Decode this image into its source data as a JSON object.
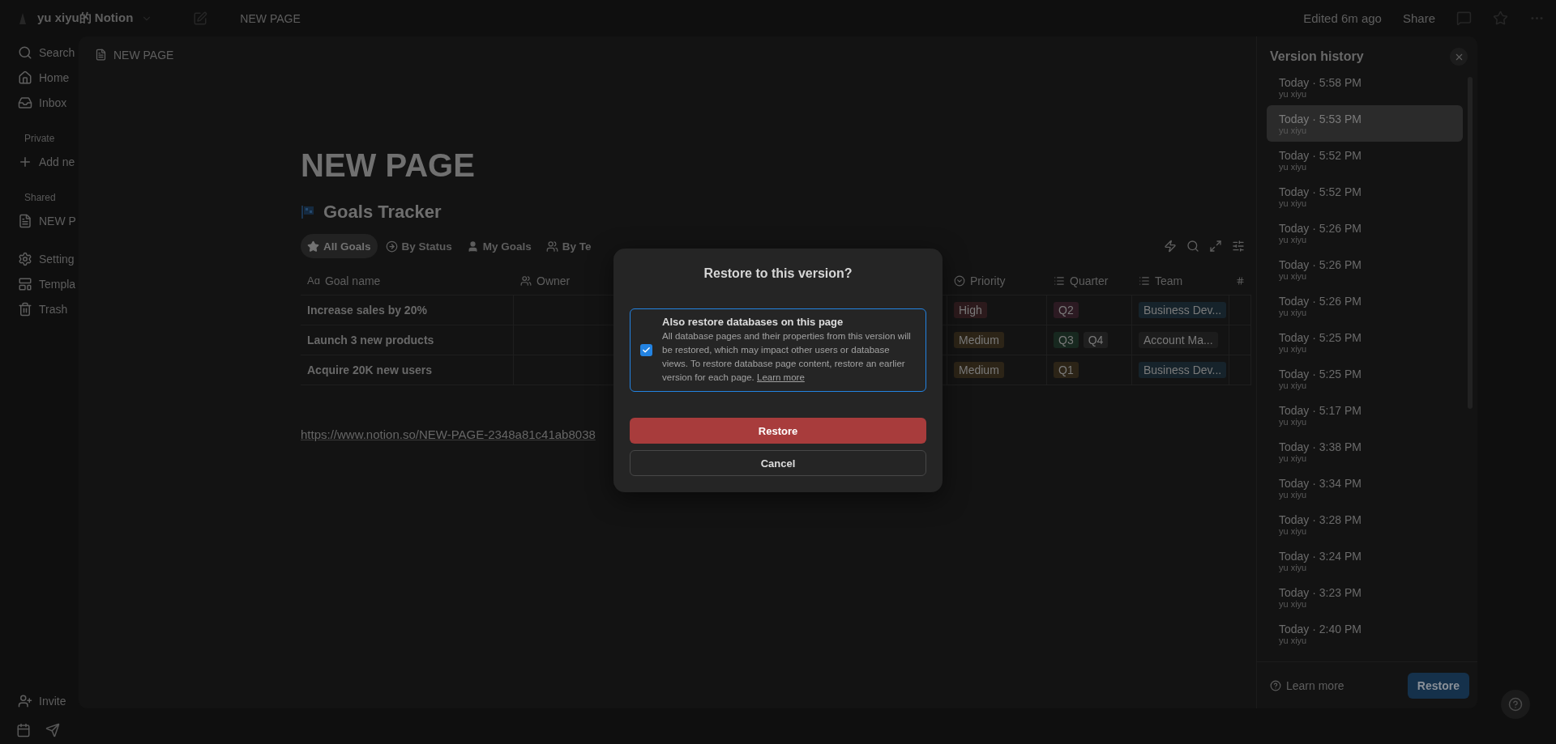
{
  "top_bar": {
    "workspace": "yu xiyu的 Notion",
    "breadcrumb": "NEW PAGE",
    "edited": "Edited 6m ago",
    "share": "Share"
  },
  "sidebar": {
    "groups": [
      {
        "items": [
          {
            "kind": "search",
            "label": "Search"
          },
          {
            "kind": "home",
            "label": "Home"
          },
          {
            "kind": "inbox",
            "label": "Inbox"
          }
        ]
      },
      {
        "heading": "Private",
        "items": [
          {
            "kind": "add",
            "label": "Add ne"
          }
        ]
      },
      {
        "heading": "Shared",
        "items": [
          {
            "kind": "page",
            "label": "NEW P"
          }
        ]
      },
      {
        "items": [
          {
            "kind": "settings",
            "label": "Setting"
          },
          {
            "kind": "templates",
            "label": "Templa"
          },
          {
            "kind": "trash",
            "label": "Trash"
          }
        ]
      }
    ],
    "invite": "Invite"
  },
  "peek": {
    "header": "NEW PAGE",
    "title": "NEW PAGE",
    "database_title": "Goals Tracker",
    "views": [
      {
        "kind": "star",
        "label": "All Goals",
        "selected": true
      },
      {
        "kind": "status",
        "label": "By Status",
        "selected": false
      },
      {
        "kind": "person",
        "label": "My Goals",
        "selected": false
      },
      {
        "kind": "people",
        "label": "By Te",
        "selected": false
      }
    ],
    "columns": [
      {
        "kind": "text",
        "icon_text": "Aɑ",
        "label": "Goal name"
      },
      {
        "kind": "person",
        "label": "Owner"
      },
      {
        "kind": "hidden"
      },
      {
        "kind": "status",
        "label": "Priority"
      },
      {
        "kind": "list",
        "label": "Quarter"
      },
      {
        "kind": "list",
        "label": "Team"
      },
      {
        "kind": "number"
      }
    ],
    "rows": [
      {
        "name": "Increase sales by 20%",
        "priority": {
          "label": "High",
          "color": "#2c1a1c"
        },
        "quarter": [
          {
            "label": "Q2",
            "color": "#2c1a22"
          }
        ],
        "team": {
          "label": "Business Dev...",
          "color": "#16232b"
        }
      },
      {
        "name": "Launch 3 new products",
        "priority": {
          "label": "Medium",
          "color": "#2c2417"
        },
        "quarter": [
          {
            "label": "Q3",
            "color": "#17281f"
          },
          {
            "label": "Q4",
            "color": "#1f1f1f"
          }
        ],
        "team": {
          "label": "Account Ma...",
          "color": "#1c1c1c"
        }
      },
      {
        "name": "Acquire 20K new users",
        "priority": {
          "label": "Medium",
          "color": "#2c2417"
        },
        "quarter": [
          {
            "label": "Q1",
            "color": "#2c2417"
          }
        ],
        "team": {
          "label": "Business Dev...",
          "color": "#16232b"
        }
      }
    ],
    "link": "https://www.notion.so/NEW-PAGE-2348a81c41ab8038"
  },
  "version_history": {
    "title": "Version history",
    "versions": [
      {
        "time": "Today · 5:58 PM",
        "author": "yu xiyu",
        "selected": false
      },
      {
        "time": "Today · 5:53 PM",
        "author": "yu xiyu",
        "selected": true
      },
      {
        "time": "Today · 5:52 PM",
        "author": "yu xiyu",
        "selected": false
      },
      {
        "time": "Today · 5:52 PM",
        "author": "yu xiyu",
        "selected": false
      },
      {
        "time": "Today · 5:26 PM",
        "author": "yu xiyu",
        "selected": false
      },
      {
        "time": "Today · 5:26 PM",
        "author": "yu xiyu",
        "selected": false
      },
      {
        "time": "Today · 5:26 PM",
        "author": "yu xiyu",
        "selected": false
      },
      {
        "time": "Today · 5:25 PM",
        "author": "yu xiyu",
        "selected": false
      },
      {
        "time": "Today · 5:25 PM",
        "author": "yu xiyu",
        "selected": false
      },
      {
        "time": "Today · 5:17 PM",
        "author": "yu xiyu",
        "selected": false
      },
      {
        "time": "Today · 3:38 PM",
        "author": "yu xiyu",
        "selected": false
      },
      {
        "time": "Today · 3:34 PM",
        "author": "yu xiyu",
        "selected": false
      },
      {
        "time": "Today · 3:28 PM",
        "author": "yu xiyu",
        "selected": false
      },
      {
        "time": "Today · 3:24 PM",
        "author": "yu xiyu",
        "selected": false
      },
      {
        "time": "Today · 3:23 PM",
        "author": "yu xiyu",
        "selected": false
      },
      {
        "time": "Today · 2:40 PM",
        "author": "yu xiyu",
        "selected": false
      }
    ],
    "learn_more": "Learn more",
    "restore": "Restore"
  },
  "dialog": {
    "title": "Restore to this version?",
    "option": {
      "checked": true,
      "label": "Also restore databases on this page",
      "description": "All database pages and their properties from this version will be restored, which may impact other users or database views. To restore database page content, restore an earlier version for each page.",
      "link": "Learn more"
    },
    "confirm": "Restore",
    "cancel": "Cancel"
  }
}
